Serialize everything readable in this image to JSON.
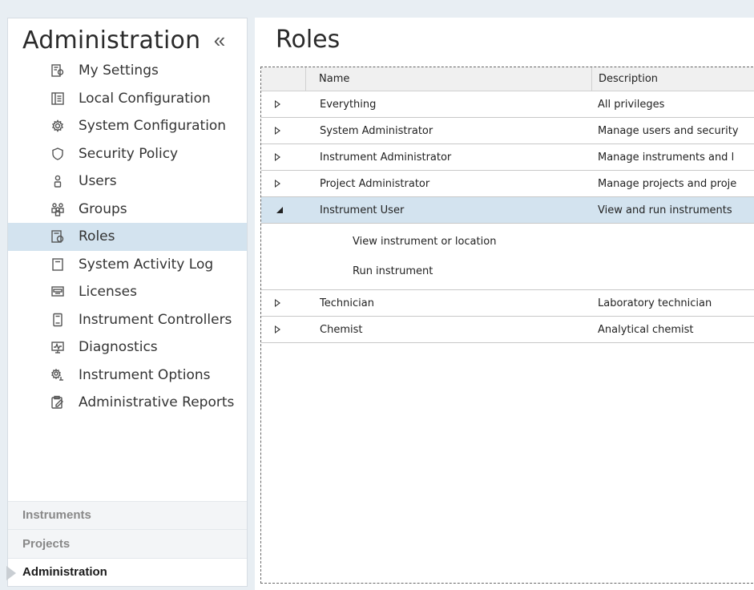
{
  "sidebar": {
    "title": "Administration",
    "collapse_label": "«",
    "items": [
      {
        "label": "My Settings",
        "icon": "settings-profile-icon",
        "selected": false
      },
      {
        "label": "Local Configuration",
        "icon": "local-config-icon",
        "selected": false
      },
      {
        "label": "System Configuration",
        "icon": "gear-icon",
        "selected": false
      },
      {
        "label": "Security Policy",
        "icon": "shield-icon",
        "selected": false
      },
      {
        "label": "Users",
        "icon": "user-icon",
        "selected": false
      },
      {
        "label": "Groups",
        "icon": "group-icon",
        "selected": false
      },
      {
        "label": "Roles",
        "icon": "roles-icon",
        "selected": true
      },
      {
        "label": "System Activity Log",
        "icon": "log-icon",
        "selected": false
      },
      {
        "label": "Licenses",
        "icon": "license-icon",
        "selected": false
      },
      {
        "label": "Instrument Controllers",
        "icon": "controller-icon",
        "selected": false
      },
      {
        "label": "Diagnostics",
        "icon": "diagnostics-icon",
        "selected": false
      },
      {
        "label": "Instrument Options",
        "icon": "instrument-options-icon",
        "selected": false
      },
      {
        "label": "Administrative Reports",
        "icon": "report-icon",
        "selected": false
      }
    ],
    "bottom_nav": [
      {
        "label": "Instruments",
        "active": false
      },
      {
        "label": "Projects",
        "active": false
      },
      {
        "label": "Administration",
        "active": true
      }
    ]
  },
  "main": {
    "title": "Roles",
    "grid": {
      "columns": {
        "name": "Name",
        "description": "Description"
      },
      "rows": [
        {
          "name": "Everything",
          "description": "All privileges",
          "expanded": false
        },
        {
          "name": "System Administrator",
          "description": "Manage users and security",
          "expanded": false
        },
        {
          "name": "Instrument Administrator",
          "description": "Manage instruments and l",
          "expanded": false
        },
        {
          "name": "Project Administrator",
          "description": "Manage projects and proje",
          "expanded": false
        },
        {
          "name": "Instrument User",
          "description": "View and run instruments",
          "expanded": true,
          "privileges": [
            "View instrument or location",
            "Run instrument"
          ]
        },
        {
          "name": "Technician",
          "description": "Laboratory technician",
          "expanded": false
        },
        {
          "name": "Chemist",
          "description": "Analytical chemist",
          "expanded": false
        }
      ]
    }
  },
  "colors": {
    "selection": "#d3e3ef",
    "background": "#e8eef3"
  }
}
